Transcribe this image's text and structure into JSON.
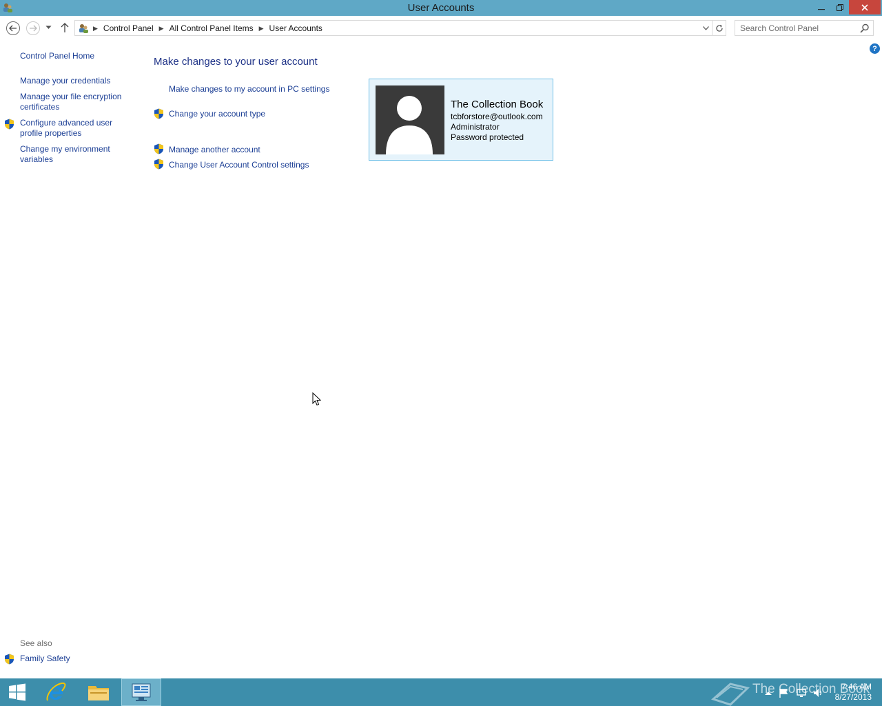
{
  "window": {
    "title": "User Accounts",
    "close_glyph": "✕",
    "minimize_glyph": "—",
    "restore_glyph": "❐"
  },
  "nav": {
    "breadcrumb": [
      "Control Panel",
      "All Control Panel Items",
      "User Accounts"
    ],
    "search_placeholder": "Search Control Panel"
  },
  "help_glyph": "?",
  "left_pane": {
    "home_link": "Control Panel Home",
    "links": [
      {
        "label": "Manage your credentials",
        "shield": false
      },
      {
        "label": "Manage your file encryption certificates",
        "shield": false
      },
      {
        "label": "Configure advanced user profile properties",
        "shield": true
      },
      {
        "label": "Change my environment variables",
        "shield": false
      }
    ],
    "see_also_label": "See also",
    "see_also_links": [
      {
        "label": "Family Safety",
        "shield": true
      }
    ]
  },
  "main": {
    "title": "Make changes to your user account",
    "tasks": [
      {
        "label": "Make changes to my account in PC settings",
        "shield": false
      },
      {
        "label": "Change your account type",
        "shield": true
      },
      {
        "label": "Manage another account",
        "shield": true
      },
      {
        "label": "Change User Account Control settings",
        "shield": true
      }
    ],
    "account": {
      "name": "The Collection Book",
      "email": "tcbforstore@outlook.com",
      "role": "Administrator",
      "status": "Password protected"
    }
  },
  "taskbar": {
    "items": [
      "start-button",
      "internet-explorer",
      "file-explorer",
      "control-panel"
    ],
    "clock_time": "7:46 AM",
    "clock_date": "8/27/2013",
    "watermark": "The Collection Book"
  },
  "colors": {
    "titlebar": "#5fa8c6",
    "taskbar": "#3d8eab",
    "link": "#1c3f95",
    "heading": "#1e3287",
    "card_bg": "#e5f3fb",
    "card_border": "#70c0e7"
  }
}
